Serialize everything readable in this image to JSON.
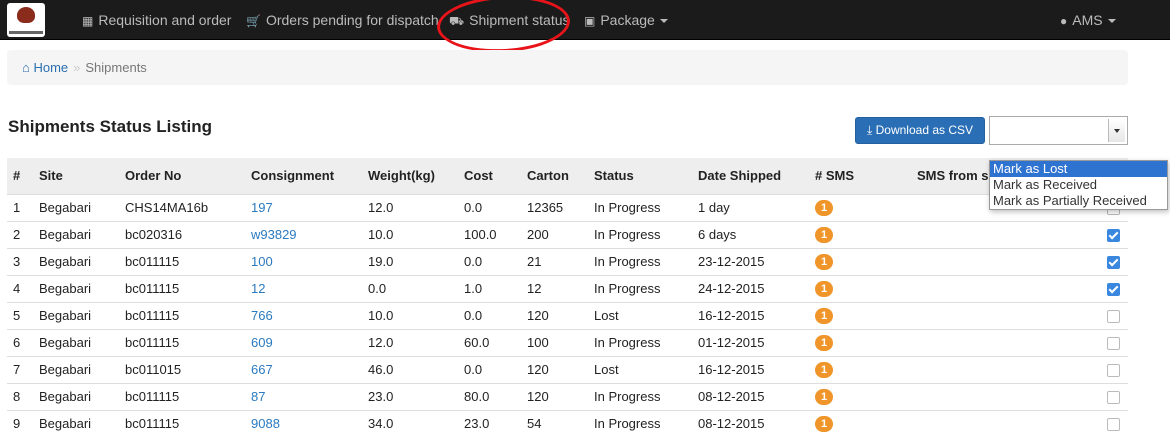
{
  "nav": {
    "items": [
      {
        "icon": "table-icon",
        "label": "Requisition and order"
      },
      {
        "icon": "cart-icon",
        "label": "Orders pending for dispatch"
      },
      {
        "icon": "truck-icon",
        "label": "Shipment status"
      },
      {
        "icon": "gift-icon",
        "label": "Package"
      }
    ],
    "user": "AMS"
  },
  "breadcrumb": {
    "home": "Home",
    "separator": "»",
    "current": "Shipments"
  },
  "page_title": "Shipments Status Listing",
  "download_label": "Download as CSV",
  "status_select": {
    "value": "",
    "options": [
      "Mark as Lost",
      "Mark as Received",
      "Mark as Partially Received"
    ],
    "highlighted": "Mark as Lost"
  },
  "table": {
    "headers": [
      "#",
      "Site",
      "Order No",
      "Consignment",
      "Weight(kg)",
      "Cost",
      "Carton",
      "Status",
      "Date Shipped",
      "# SMS",
      "SMS from s"
    ],
    "rows": [
      {
        "n": "1",
        "site": "Begabari",
        "order": "CHS14MA16b",
        "consignment": "197",
        "weight": "12.0",
        "cost": "0.0",
        "carton": "12365",
        "status": "In Progress",
        "date": "1 day",
        "sms": "1",
        "checked": false
      },
      {
        "n": "2",
        "site": "Begabari",
        "order": "bc020316",
        "consignment": "w93829",
        "weight": "10.0",
        "cost": "100.0",
        "carton": "200",
        "status": "In Progress",
        "date": "6 days",
        "sms": "1",
        "checked": true
      },
      {
        "n": "3",
        "site": "Begabari",
        "order": "bc011115",
        "consignment": "100",
        "weight": "19.0",
        "cost": "0.0",
        "carton": "21",
        "status": "In Progress",
        "date": "23-12-2015",
        "sms": "1",
        "checked": true
      },
      {
        "n": "4",
        "site": "Begabari",
        "order": "bc011115",
        "consignment": "12",
        "weight": "0.0",
        "cost": "1.0",
        "carton": "12",
        "status": "In Progress",
        "date": "24-12-2015",
        "sms": "1",
        "checked": true
      },
      {
        "n": "5",
        "site": "Begabari",
        "order": "bc011115",
        "consignment": "766",
        "weight": "10.0",
        "cost": "0.0",
        "carton": "120",
        "status": "Lost",
        "date": "16-12-2015",
        "sms": "1",
        "checked": false
      },
      {
        "n": "6",
        "site": "Begabari",
        "order": "bc011115",
        "consignment": "609",
        "weight": "12.0",
        "cost": "60.0",
        "carton": "100",
        "status": "In Progress",
        "date": "01-12-2015",
        "sms": "1",
        "checked": false
      },
      {
        "n": "7",
        "site": "Begabari",
        "order": "bc011015",
        "consignment": "667",
        "weight": "46.0",
        "cost": "0.0",
        "carton": "120",
        "status": "Lost",
        "date": "16-12-2015",
        "sms": "1",
        "checked": false
      },
      {
        "n": "8",
        "site": "Begabari",
        "order": "bc011115",
        "consignment": "87",
        "weight": "23.0",
        "cost": "80.0",
        "carton": "120",
        "status": "In Progress",
        "date": "08-12-2015",
        "sms": "1",
        "checked": false
      },
      {
        "n": "9",
        "site": "Begabari",
        "order": "bc011115",
        "consignment": "9088",
        "weight": "34.0",
        "cost": "23.0",
        "carton": "54",
        "status": "In Progress",
        "date": "08-12-2015",
        "sms": "1",
        "checked": false
      }
    ]
  },
  "colors": {
    "navbar": "#1b1b1b",
    "link": "#2a7ac0",
    "button": "#2a6fb6",
    "badge": "#f0952a",
    "annotation": "#e8141a"
  }
}
